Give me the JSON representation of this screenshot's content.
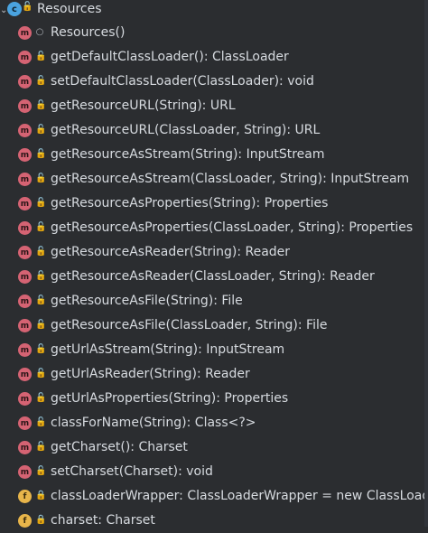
{
  "root": {
    "label": "Resources",
    "chevron": "chevron-down-icon",
    "icon": "class-icon",
    "icon_letter": "c",
    "visibility": "public-lock-icon"
  },
  "members": [
    {
      "label": "Resources()",
      "icon": "method",
      "visibility": "package"
    },
    {
      "label": "getDefaultClassLoader(): ClassLoader",
      "icon": "method",
      "visibility": "public"
    },
    {
      "label": "setDefaultClassLoader(ClassLoader): void",
      "icon": "method",
      "visibility": "public"
    },
    {
      "label": "getResourceURL(String): URL",
      "icon": "method",
      "visibility": "public"
    },
    {
      "label": "getResourceURL(ClassLoader, String): URL",
      "icon": "method",
      "visibility": "public"
    },
    {
      "label": "getResourceAsStream(String): InputStream",
      "icon": "method",
      "visibility": "public"
    },
    {
      "label": "getResourceAsStream(ClassLoader, String): InputStream",
      "icon": "method",
      "visibility": "public"
    },
    {
      "label": "getResourceAsProperties(String): Properties",
      "icon": "method",
      "visibility": "public"
    },
    {
      "label": "getResourceAsProperties(ClassLoader, String): Properties",
      "icon": "method",
      "visibility": "public"
    },
    {
      "label": "getResourceAsReader(String): Reader",
      "icon": "method",
      "visibility": "public"
    },
    {
      "label": "getResourceAsReader(ClassLoader, String): Reader",
      "icon": "method",
      "visibility": "public"
    },
    {
      "label": "getResourceAsFile(String): File",
      "icon": "method",
      "visibility": "public"
    },
    {
      "label": "getResourceAsFile(ClassLoader, String): File",
      "icon": "method",
      "visibility": "public"
    },
    {
      "label": "getUrlAsStream(String): InputStream",
      "icon": "method",
      "visibility": "public"
    },
    {
      "label": "getUrlAsReader(String): Reader",
      "icon": "method",
      "visibility": "public"
    },
    {
      "label": "getUrlAsProperties(String): Properties",
      "icon": "method",
      "visibility": "public"
    },
    {
      "label": "classForName(String): Class<?>",
      "icon": "method",
      "visibility": "public"
    },
    {
      "label": "getCharset(): Charset",
      "icon": "method",
      "visibility": "public"
    },
    {
      "label": "setCharset(Charset): void",
      "icon": "method",
      "visibility": "public"
    },
    {
      "label": "classLoaderWrapper: ClassLoaderWrapper = new ClassLoaderWrapper()",
      "icon": "field",
      "visibility": "private"
    },
    {
      "label": "charset: Charset",
      "icon": "field",
      "visibility": "private"
    }
  ],
  "icon_glyphs": {
    "method": "m",
    "field": "f",
    "public": "🔓",
    "private": "🔒",
    "package": "○"
  }
}
